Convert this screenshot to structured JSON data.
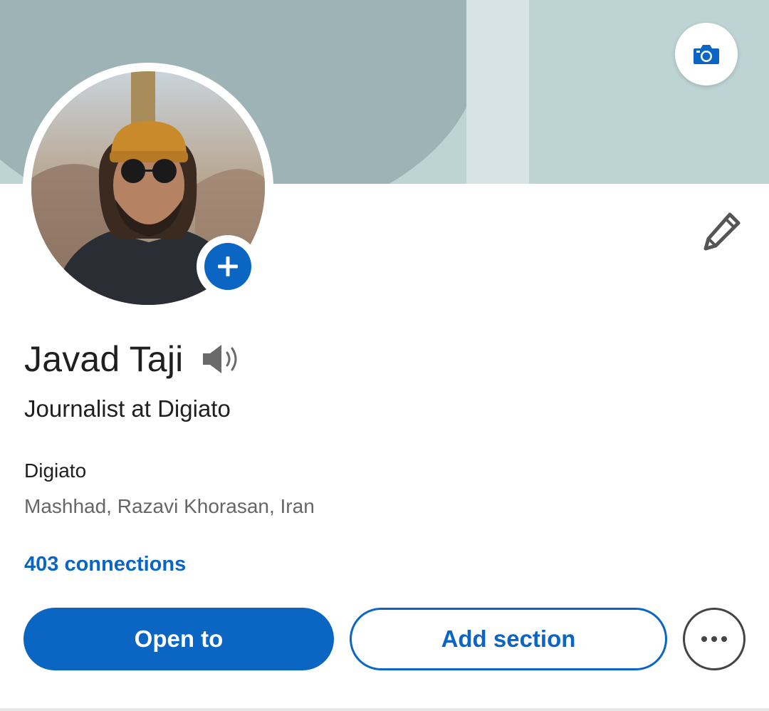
{
  "profile": {
    "name": "Javad Taji",
    "headline": "Journalist at Digiato",
    "company": "Digiato",
    "location": "Mashhad, Razavi Khorasan, Iran",
    "connections": "403 connections"
  },
  "actions": {
    "open_to_label": "Open to",
    "add_section_label": "Add section",
    "more_icon": "more-horizontal-icon"
  },
  "icons": {
    "cover_camera": "camera-icon",
    "add_photo": "plus-icon",
    "edit": "pencil-icon",
    "pronunciation": "speaker-icon"
  },
  "colors": {
    "accent": "#0a66c2",
    "banner": "#bdd3d4",
    "banner_shape": "#9eb3b6",
    "text": "#1f1f1f",
    "muted": "#666666"
  }
}
